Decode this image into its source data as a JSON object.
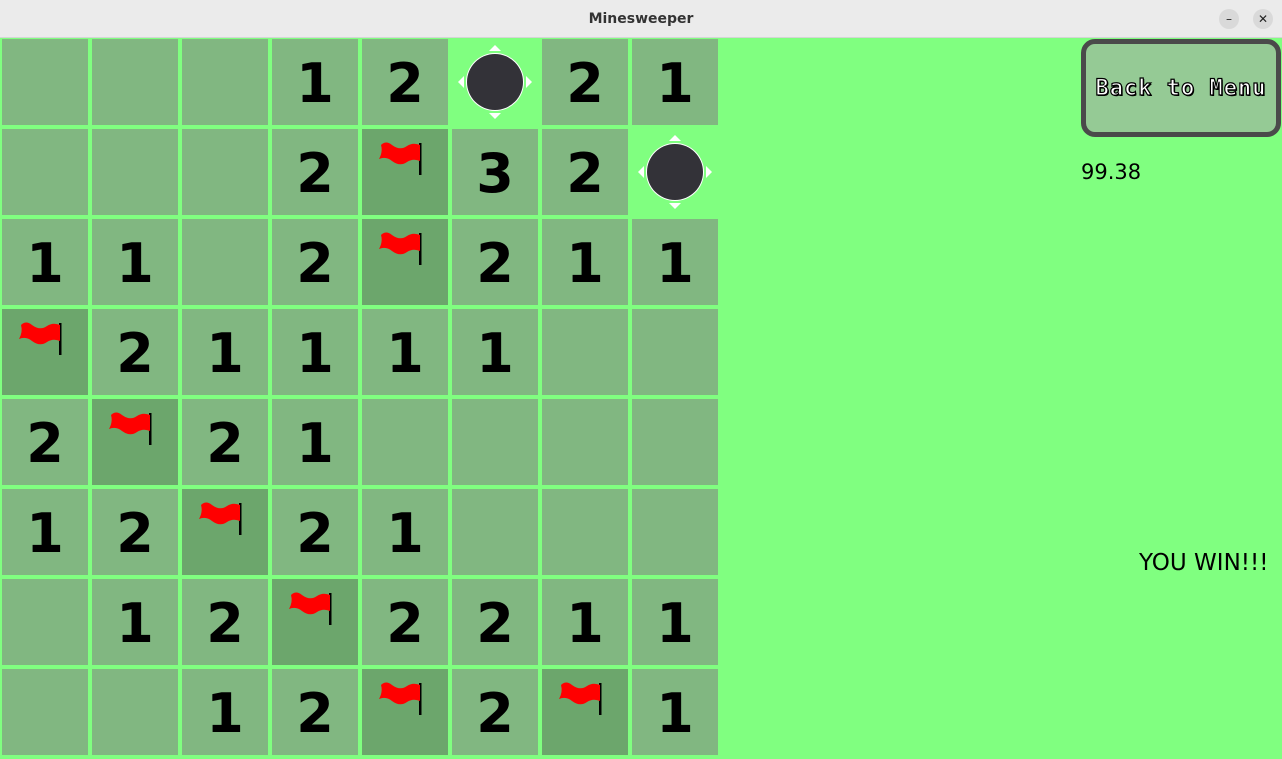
{
  "window": {
    "title": "Minesweeper",
    "minimize_glyph": "–",
    "close_glyph": "✕"
  },
  "board": {
    "rows": 8,
    "cols": 8,
    "cells": [
      [
        "",
        "",
        "",
        "1",
        "2",
        "M",
        "2",
        "1"
      ],
      [
        "",
        "",
        "",
        "2",
        "F",
        "3",
        "2",
        "M"
      ],
      [
        "1",
        "1",
        "",
        "2",
        "F",
        "2",
        "1",
        "1"
      ],
      [
        "F",
        "2",
        "1",
        "1",
        "1",
        "1",
        "",
        ""
      ],
      [
        "2",
        "F",
        "2",
        "1",
        "",
        "",
        "",
        ""
      ],
      [
        "1",
        "2",
        "F",
        "2",
        "1",
        "",
        "",
        ""
      ],
      [
        "",
        "1",
        "2",
        "F",
        "2",
        "2",
        "1",
        "1"
      ],
      [
        "",
        "",
        "1",
        "2",
        "F",
        "2",
        "F",
        "1"
      ]
    ],
    "legend": {
      "M": "mine",
      "F": "flag",
      "": "empty"
    }
  },
  "sidebar": {
    "menu_button_label": "Back to Menu",
    "timer": "99.38",
    "status": "YOU WIN!!!"
  },
  "colors": {
    "background": "#80ff80",
    "cell": "#81b781",
    "flagged_cell": "#6ca66c",
    "flag": "#ff0000",
    "mine": "#333238"
  }
}
